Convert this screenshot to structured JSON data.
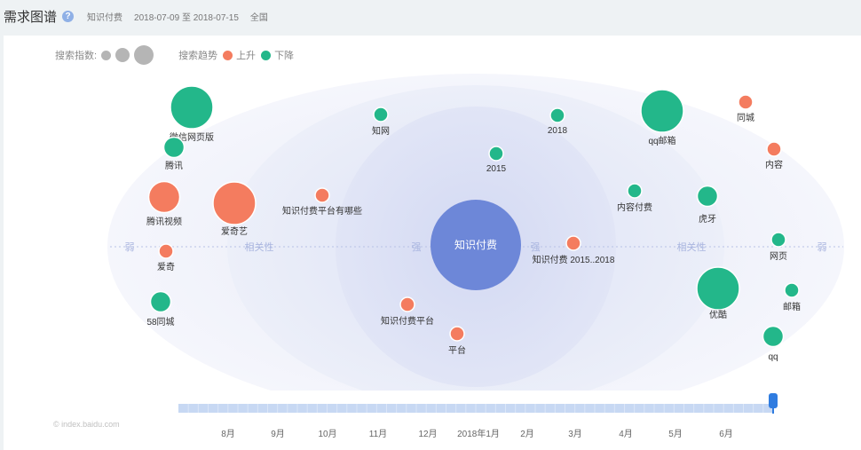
{
  "header": {
    "title": "需求图谱",
    "help_glyph": "?",
    "keyword": "知识付费",
    "date_range": "2018-07-09 至 2018-07-15",
    "region": "全国"
  },
  "legend": {
    "index_label": "搜索指数:",
    "trend_label": "搜索趋势",
    "up_label": "上升",
    "down_label": "下降"
  },
  "colors": {
    "up": "#f47c5f",
    "down": "#23b78a",
    "center": "#6d87d8",
    "axis_text": "#a9b5df"
  },
  "axis_labels": [
    "弱",
    "相关性",
    "强",
    "强",
    "相关性",
    "弱"
  ],
  "center_node": {
    "label": "知识付费"
  },
  "nodes": [
    {
      "label": "微信网页版",
      "trend": "down",
      "size": "large"
    },
    {
      "label": "腾讯",
      "trend": "down",
      "size": "small"
    },
    {
      "label": "腾讯视频",
      "trend": "up",
      "size": "medium"
    },
    {
      "label": "爱奇艺",
      "trend": "up",
      "size": "large"
    },
    {
      "label": "爱奇",
      "trend": "up",
      "size": "tiny"
    },
    {
      "label": "58同城",
      "trend": "down",
      "size": "small"
    },
    {
      "label": "知识付费平台有哪些",
      "trend": "up",
      "size": "tiny"
    },
    {
      "label": "知网",
      "trend": "down",
      "size": "tiny"
    },
    {
      "label": "2015",
      "trend": "down",
      "size": "tiny"
    },
    {
      "label": "2018",
      "trend": "down",
      "size": "tiny"
    },
    {
      "label": "知识付费 2015..2018",
      "trend": "up",
      "size": "tiny"
    },
    {
      "label": "知识付费平台",
      "trend": "up",
      "size": "tiny"
    },
    {
      "label": "平台",
      "trend": "up",
      "size": "tiny"
    },
    {
      "label": "qq邮箱",
      "trend": "down",
      "size": "large"
    },
    {
      "label": "同城",
      "trend": "up",
      "size": "tiny"
    },
    {
      "label": "内容",
      "trend": "up",
      "size": "tiny"
    },
    {
      "label": "内容付费",
      "trend": "down",
      "size": "tiny"
    },
    {
      "label": "虎牙",
      "trend": "down",
      "size": "small"
    },
    {
      "label": "网页",
      "trend": "down",
      "size": "tiny"
    },
    {
      "label": "优酷",
      "trend": "down",
      "size": "large"
    },
    {
      "label": "邮箱",
      "trend": "down",
      "size": "tiny"
    },
    {
      "label": "qq",
      "trend": "down",
      "size": "small"
    }
  ],
  "timeline": {
    "months": [
      "8月",
      "9月",
      "10月",
      "11月",
      "12月",
      "2018年1月",
      "2月",
      "3月",
      "4月",
      "5月",
      "6月"
    ],
    "selected_position": 1.0
  },
  "watermark": "© index.baidu.com"
}
